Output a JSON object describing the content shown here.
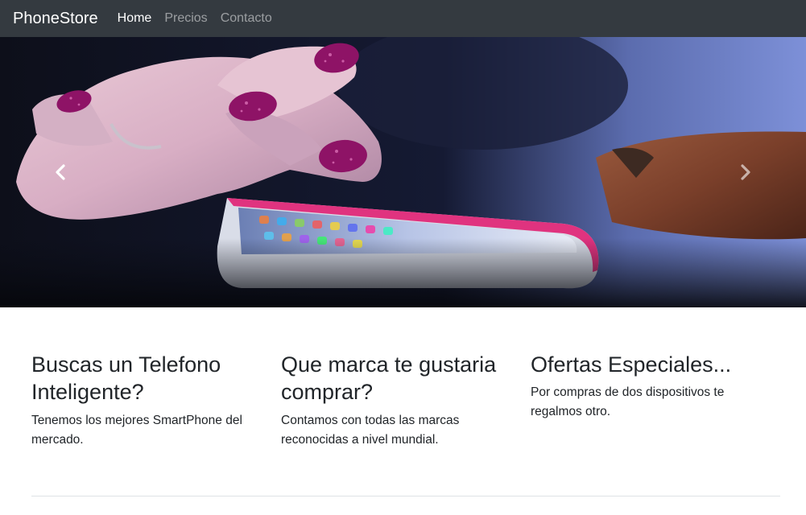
{
  "navbar": {
    "brand": "PhoneStore",
    "links": [
      {
        "label": "Home",
        "active": true
      },
      {
        "label": "Precios",
        "active": false
      },
      {
        "label": "Contacto",
        "active": false
      }
    ]
  },
  "carousel": {
    "prev_icon": "chevron-left-icon",
    "next_icon": "chevron-right-icon"
  },
  "features": [
    {
      "heading": "Buscas un Telefono Inteligente?",
      "text": "Tenemos los mejores SmartPhone del mercado."
    },
    {
      "heading": "Que marca te gustaria comprar?",
      "text": "Contamos con todas las marcas reconocidas a nivel mundial."
    },
    {
      "heading": "Ofertas Especiales...",
      "text": "Por compras de dos dispositivos te regalmos otro."
    }
  ],
  "colors": {
    "navbar_bg": "#343a40",
    "text": "#212529",
    "divider": "#dee2e6"
  }
}
